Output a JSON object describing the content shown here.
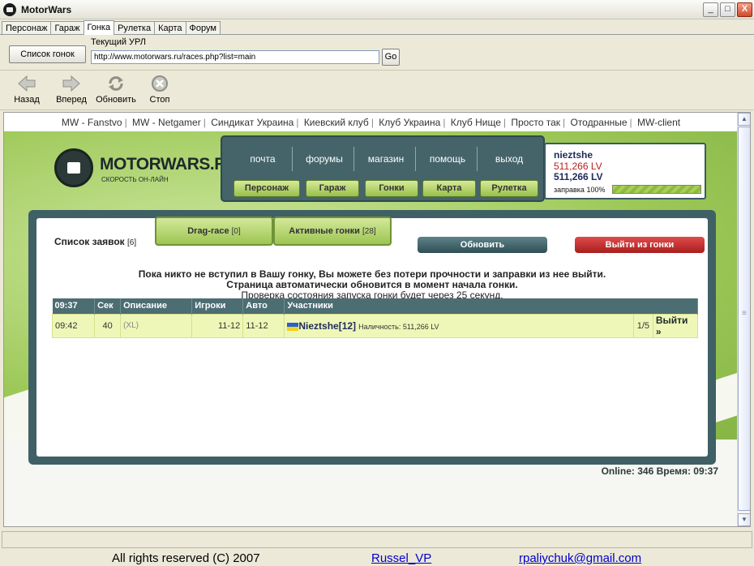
{
  "window": {
    "title": "MotorWars",
    "min": "_",
    "max": "□",
    "close": "X"
  },
  "tabs": [
    "Персонаж",
    "Гараж",
    "Гонка",
    "Рулетка",
    "Карта",
    "Форум"
  ],
  "active_tab": "Гонка",
  "toolbar": {
    "list_button": "Список гонок",
    "url_label": "Текущий УРЛ",
    "url_value": "http://www.motorwars.ru/races.php?list=main",
    "go_button": "Go",
    "back": "Назад",
    "forward": "Вперед",
    "refresh": "Обновить",
    "stop": "Стоп"
  },
  "site": {
    "top_links": [
      "MW - Fanstvo",
      "MW - Netgamer",
      "Синдикат Украина",
      "Киевский клуб",
      "Клуб Украина",
      "Клуб Нище",
      "Просто так",
      "Отодранные",
      "MW-client"
    ],
    "logo_name": "MOTORWARS.RU",
    "logo_slogan": "СКОРОСТЬ ОН-ЛАЙН",
    "nav_links": [
      "почта",
      "форумы",
      "магазин",
      "помощь",
      "выход"
    ],
    "nav_buttons": [
      "Персонаж",
      "Гараж",
      "Гонки",
      "Карта",
      "Рулетка"
    ],
    "user": {
      "name": "nieztshe",
      "money_red": "511,266 LV",
      "money_blue": "511,266 LV",
      "fuel_label": "заправка 100%",
      "fuel_fraction": 1.0
    },
    "race": {
      "requests_tab": "Список заявок",
      "requests_count": "[6]",
      "drag_tab": "Drag-race",
      "drag_count": "[0]",
      "active_tab": "Активные гонки",
      "active_count": "[28]",
      "refresh_button": "Обновить",
      "leave_button": "Выйти из гонки",
      "notice_line1": "Пока никто не вступил в Вашу гонку, Вы можете без потери прочности и заправки из нее выйти.",
      "notice_line2": "Страница автоматически обновится в момент начала гонки.",
      "notice_line3": "Проверка состояния запуска гонки будет через 25 секунд.",
      "columns": [
        "09:37",
        "Сек",
        "Описание",
        "Игроки",
        "Авто",
        "Участники"
      ],
      "rows": [
        {
          "time": "09:42",
          "sec": "40",
          "desc": "(XL)",
          "players": "11-12",
          "auto": "11-12",
          "participant": "Nieztshe[12]",
          "cash": "Наличность: 511,266 LV",
          "slots": "1/5",
          "action": "Выйти »"
        }
      ]
    },
    "online": "Online: 346  Время: 09:37"
  },
  "footer": {
    "copyright": "All rights reserved (C) 2007",
    "author": "Russel_VP",
    "email": "rpaliychuk@gmail.com"
  },
  "colors": {
    "accent_green": "#9cc552",
    "panel_teal": "#3f6064",
    "leave_red": "#c72d2d",
    "row_yellow": "#eff7b8"
  }
}
